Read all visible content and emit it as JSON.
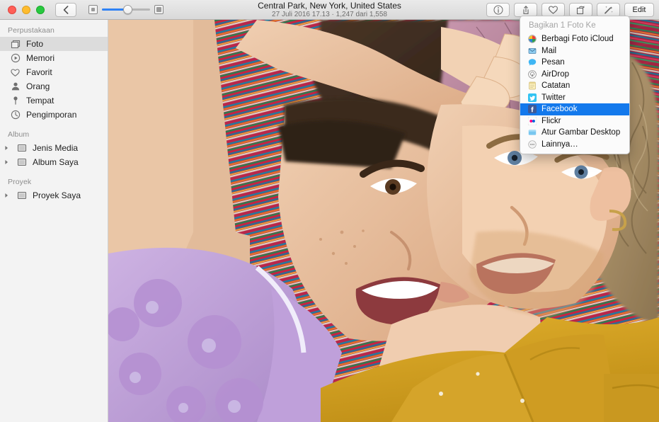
{
  "window": {
    "title": "Central Park, New York, United States",
    "subtitle": "27 Juli 2016 17.13  ·  1,247 dari 1,558"
  },
  "toolbar": {
    "back_label": "‹",
    "zoom_small_icon": "small-image-icon",
    "zoom_large_icon": "large-image-icon",
    "buttons": [
      {
        "name": "info-button",
        "label": "i"
      },
      {
        "name": "share-button",
        "label": "share"
      },
      {
        "name": "favorite-button",
        "label": "heart"
      },
      {
        "name": "rotate-button",
        "label": "rotate"
      },
      {
        "name": "enhance-button",
        "label": "wand"
      }
    ],
    "edit_label": "Edit",
    "accent_color": "#2f82f5"
  },
  "sidebar": {
    "sections": [
      {
        "header": "Perpustakaan",
        "items": [
          {
            "label": "Foto",
            "icon": "photos-icon",
            "selected": true
          },
          {
            "label": "Memori",
            "icon": "memories-icon",
            "selected": false
          },
          {
            "label": "Favorit",
            "icon": "heart-icon",
            "selected": false
          },
          {
            "label": "Orang",
            "icon": "person-icon",
            "selected": false
          },
          {
            "label": "Tempat",
            "icon": "pin-icon",
            "selected": false
          },
          {
            "label": "Pengimporan",
            "icon": "clock-icon",
            "selected": false
          }
        ]
      },
      {
        "header": "Album",
        "items": [
          {
            "label": "Jenis Media",
            "icon": "folder-icon",
            "disclosure": true
          },
          {
            "label": "Album Saya",
            "icon": "folder-icon",
            "disclosure": true
          }
        ]
      },
      {
        "header": "Proyek",
        "items": [
          {
            "label": "Proyek Saya",
            "icon": "folder-icon",
            "disclosure": true
          }
        ]
      }
    ]
  },
  "share_menu": {
    "title": "Bagikan 1 Foto Ke",
    "highlight_color": "#1379ec",
    "items": [
      {
        "label": "Berbagi Foto iCloud",
        "icon": "icloud-photo-sharing-icon",
        "highlighted": false
      },
      {
        "label": "Mail",
        "icon": "mail-icon",
        "highlighted": false
      },
      {
        "label": "Pesan",
        "icon": "messages-icon",
        "highlighted": false
      },
      {
        "label": "AirDrop",
        "icon": "airdrop-icon",
        "highlighted": false
      },
      {
        "label": "Catatan",
        "icon": "notes-icon",
        "highlighted": false
      },
      {
        "label": "Twitter",
        "icon": "twitter-icon",
        "highlighted": false
      },
      {
        "label": "Facebook",
        "icon": "facebook-icon",
        "highlighted": true
      },
      {
        "label": "Flickr",
        "icon": "flickr-icon",
        "highlighted": false
      },
      {
        "label": "Atur Gambar Desktop",
        "icon": "desktop-picture-icon",
        "highlighted": false
      },
      {
        "label": "Lainnya…",
        "icon": "more-icon",
        "highlighted": false
      }
    ]
  },
  "photo": {
    "description": "Two people lying on a striped blanket smiling",
    "colors": {
      "skin": "#e8c0a0",
      "yellow_shirt": "#d8a427",
      "purple_lace": "#c3a8db",
      "pink_hair": "#b98ba4",
      "blanket_red": "#b9274a",
      "blanket_green": "#2e7d4f",
      "blond_hair": "#a99070"
    }
  }
}
